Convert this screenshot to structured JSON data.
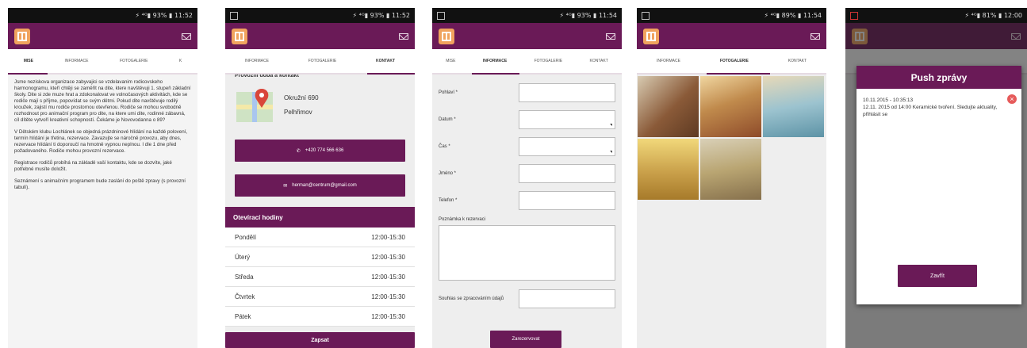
{
  "status": {
    "s1": "⚡ ⁴ᴳ▮ 93% ▮ 11:52",
    "s2": "⚡ ⁴ᴳ▮ 93% ▮ 11:52",
    "s3": "⚡ ⁴ᴳ▮ 93% ▮ 11:54",
    "s4": "⚡ ⁴ᴳ▮ 89% ▮ 11:54",
    "s5": "⚡ ⁴ᴳ▮ 81% ▮ 12:00"
  },
  "screen1": {
    "tabs": [
      "Mise",
      "Informace",
      "Fotogalerie",
      "K"
    ],
    "paragraphs": [
      "Jsme neziskova organizace zabyvajici se vzdelavanim rodicovskeho harmonogramu, kteří chtěji se zaměřit na dite, ktere navštěvuji 1. stupeň základní školy. Dite si zde muze hrat a zdokonalovat ve volnočasových aktivitách, kde se rodiče mají s příjme, popovídat se svým dětmi. Pokud dite navštěvuje rodilý kroužek, zajistí mu rodiče prostornou otevřenou. Rodiče se mohou svobodně rozhodnout pro animační program pro dite, na ktere umi dite, rodinné zábavná, cíl dítěte vytvoří kreativní schopností. Čekáme je Novovodanna o 89?",
      "V Dětském klubu Lochlánek se objedná prázdninové hlídání na každé polovení, termín hlídání je třetina, rezervace. Zavazujte se náročně provozu, aby dnes, rezervace hlídání ti doporoučí na hmotně vypnou neplnou. I dle 1 dne před požadovaného. Rodiče mohou provozní rezervace.",
      "Registrace rodičů probíhá na základě vaší kontaktu, kde se dozvíte, jaké potřebné musíte doložit.",
      "Seznámení s animačním programem bude zaslání do poště zpravy (s provozní tabulí)."
    ]
  },
  "screen2": {
    "tabs": [
      "Informace",
      "Fotogalerie",
      "Kontakt"
    ],
    "section_title": "Provozní doba a kontakt",
    "address_line1": "Okružní 690",
    "address_line2": "Pelhřimov",
    "phone_label": "+420 774 566 636",
    "email_label": "herman@centrum@gmail.com",
    "hours_title": "Otevírací hodiny",
    "hours": [
      {
        "day": "Pondělí",
        "time": "12:00-15:30"
      },
      {
        "day": "Úterý",
        "time": "12:00-15:30"
      },
      {
        "day": "Středa",
        "time": "12:00-15:30"
      },
      {
        "day": "Čtvrtek",
        "time": "12:00-15:30"
      },
      {
        "day": "Pátek",
        "time": "12:00-15:30"
      }
    ],
    "bottom_button": "Zapsat"
  },
  "screen3": {
    "tabs": [
      "Mise",
      "Informace",
      "Fotogalerie",
      "Kontakt"
    ],
    "fields": [
      "Pohlaví *",
      "Datum *",
      "Čas *",
      "Jméno *",
      "Telefon *"
    ],
    "note_label": "Poznámka k rezervaci",
    "consent_label": "Souhlas se zpracováním údajů",
    "submit": "Zarezervovat"
  },
  "screen4": {
    "tabs": [
      "Informace",
      "Fotogalerie",
      "Kontakt"
    ],
    "photo_colors": [
      "#8a5a38",
      "#c08a4c",
      "#7aa7b8",
      "#c9a04a",
      "#9a8a62"
    ]
  },
  "screen5": {
    "dialog_title": "Push zprávy",
    "message_date": "10.11.2015 - 10:35:13",
    "message_text": "12.11. 2015 od 14:00 Keramické tvoření. Sledujte aktuality, přihlásit se",
    "close_button": "Zavřít"
  },
  "colors": {
    "primary": "#6a1a57",
    "accent": "#f0a35e",
    "close": "#e65b5b"
  }
}
